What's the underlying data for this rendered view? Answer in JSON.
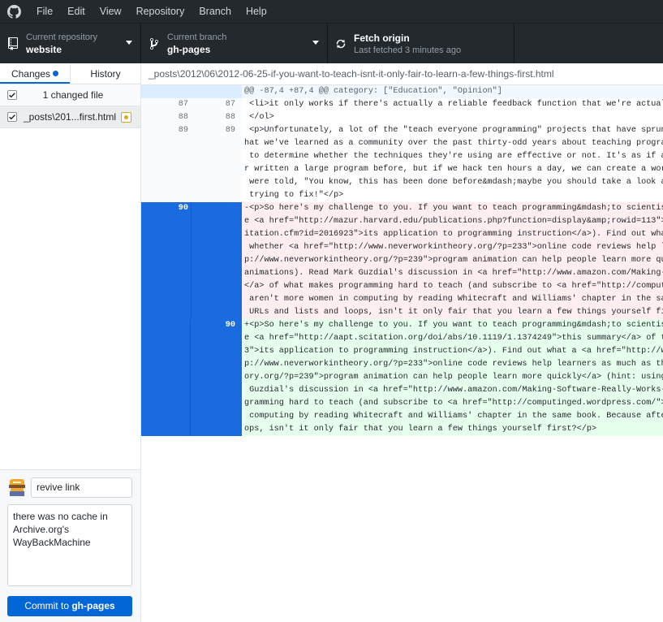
{
  "menu": [
    "File",
    "Edit",
    "View",
    "Repository",
    "Branch",
    "Help"
  ],
  "toolbar": {
    "repo_label": "Current repository",
    "repo_value": "website",
    "branch_label": "Current branch",
    "branch_value": "gh-pages",
    "fetch_label": "Fetch origin",
    "fetch_sub": "Last fetched 3 minutes ago"
  },
  "sidebar": {
    "tab_changes": "Changes",
    "tab_history": "History",
    "changed_count": "1 changed file",
    "file_name": "_posts\\201...first.html"
  },
  "commit": {
    "summary": "revive link",
    "description": "there was no cache in\nArchive.org's\nWayBackMachine",
    "button_prefix": "Commit to ",
    "button_branch": "gh-pages"
  },
  "diff": {
    "path": "_posts\\2012\\06\\2012-06-25-if-you-want-to-teach-isnt-it-only-fair-to-learn-a-few-things-first.html",
    "hunk": "@@ -87,4 +87,4 @@ category: [\"Education\", \"Opinion\"]",
    "context": [
      {
        "old": "87",
        "new": "87",
        "text": " <li>it only works if there's actually a reliable feedback function that we're actually"
      },
      {
        "old": "88",
        "new": "88",
        "text": " </ol>"
      },
      {
        "old": "89",
        "new": "89",
        "text": " <p>Unfortunately, a lot of the \"teach everyone programming\" projects that have sprung"
      },
      {
        "old": "",
        "new": "",
        "text": "hat we've learned as a community over the past thirty-odd years about teaching progra"
      },
      {
        "old": "",
        "new": "",
        "text": " to determine whether the techniques they're using are effective or not. It's as if a"
      },
      {
        "old": "",
        "new": "",
        "text": "r written a large program before, but if we hack ten hours a day, we can create a wor"
      },
      {
        "old": "",
        "new": "",
        "text": " were told, \"You know, this has been done before&mdash;maybe you should take a look a"
      },
      {
        "old": "",
        "new": "",
        "text": " trying to fix!\"</p>"
      }
    ],
    "deleted_num": "90",
    "deleted": [
      "-<p>So here's my challenge to you. If you want to teach programming&mdash;to scientis",
      "e <a href=\"http://mazur.harvard.edu/publications.php?function=display&amp;rowid=113\">",
      "itation.cfm?id=2016923\">its application to programming instruction</a>). Find out wha",
      " whether <a href=\"http://www.neverworkintheory.org/?p=233\">online code reviews help l",
      "p://www.neverworkintheory.org/?p=239\">program animation can help people learn more qu",
      "animations). Read Mark Guzdial's discussion in <a href=\"http://www.amazon.com/Making-",
      "</a> of what makes programming hard to teach (and subscribe to <a href=\"http://comput",
      " aren't more women in computing by reading Whitecraft and Williams' chapter in the sa",
      " URLs and lists and loops, isn't it only fair that you learn a few things yourself fi"
    ],
    "added_num": "90",
    "added": [
      "+<p>So here's my challenge to you. If you want to teach programming&mdash;to scientis",
      "e <a href=\"http://aapt.scitation.org/doi/abs/10.1119/1.1374249\">this summary</a> of t",
      "3\">its application to programming instruction</a>). Find out what a <a href=\"http://w",
      "p://www.neverworkintheory.org/?p=233\">online code reviews help learners as much as th",
      "ory.org/?p=239\">program animation can help people learn more quickly</a> (hint: using",
      " Guzdial's discussion in <a href=\"http://www.amazon.com/Making-Software-Really-Works-",
      "gramming hard to teach (and subscribe to <a href=\"http://computinged.wordpress.com/\">",
      " computing by reading Whitecraft and Williams' chapter in the same book. Because afte",
      "ops, isn't it only fair that you learn a few things yourself first?</p>"
    ]
  },
  "colors": {
    "accent": "#0366d6",
    "selection": "#1b6be0",
    "deleted_bg": "#ffeef0",
    "added_bg": "#e6ffed",
    "toolbar_bg": "#24292e"
  }
}
